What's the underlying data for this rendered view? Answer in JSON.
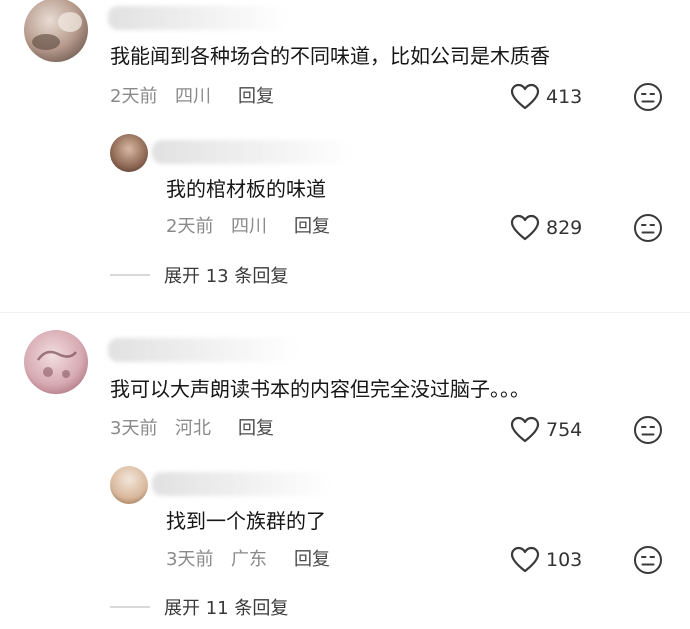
{
  "comments": [
    {
      "text": "我能闻到各种场合的不同味道，比如公司是木质香",
      "time": "2天前",
      "location": "四川",
      "reply_label": "回复",
      "likes": "413",
      "reply": {
        "text": "我的棺材板的味道",
        "time": "2天前",
        "location": "四川",
        "reply_label": "回复",
        "likes": "829"
      },
      "expand_label": "展开 13 条回复"
    },
    {
      "text": "我可以大声朗读书本的内容但完全没过脑子。。。",
      "time": "3天前",
      "location": "河北",
      "reply_label": "回复",
      "likes": "754",
      "reply": {
        "text": "找到一个族群的了",
        "time": "3天前",
        "location": "广东",
        "reply_label": "回复",
        "likes": "103"
      },
      "expand_label": "展开 11 条回复"
    }
  ],
  "icons": {
    "like": "heart-outline-icon",
    "dislike": "meh-face-icon"
  },
  "colors": {
    "text": "#161616",
    "meta": "#8a8a8a",
    "icon": "#3a3a3a"
  }
}
